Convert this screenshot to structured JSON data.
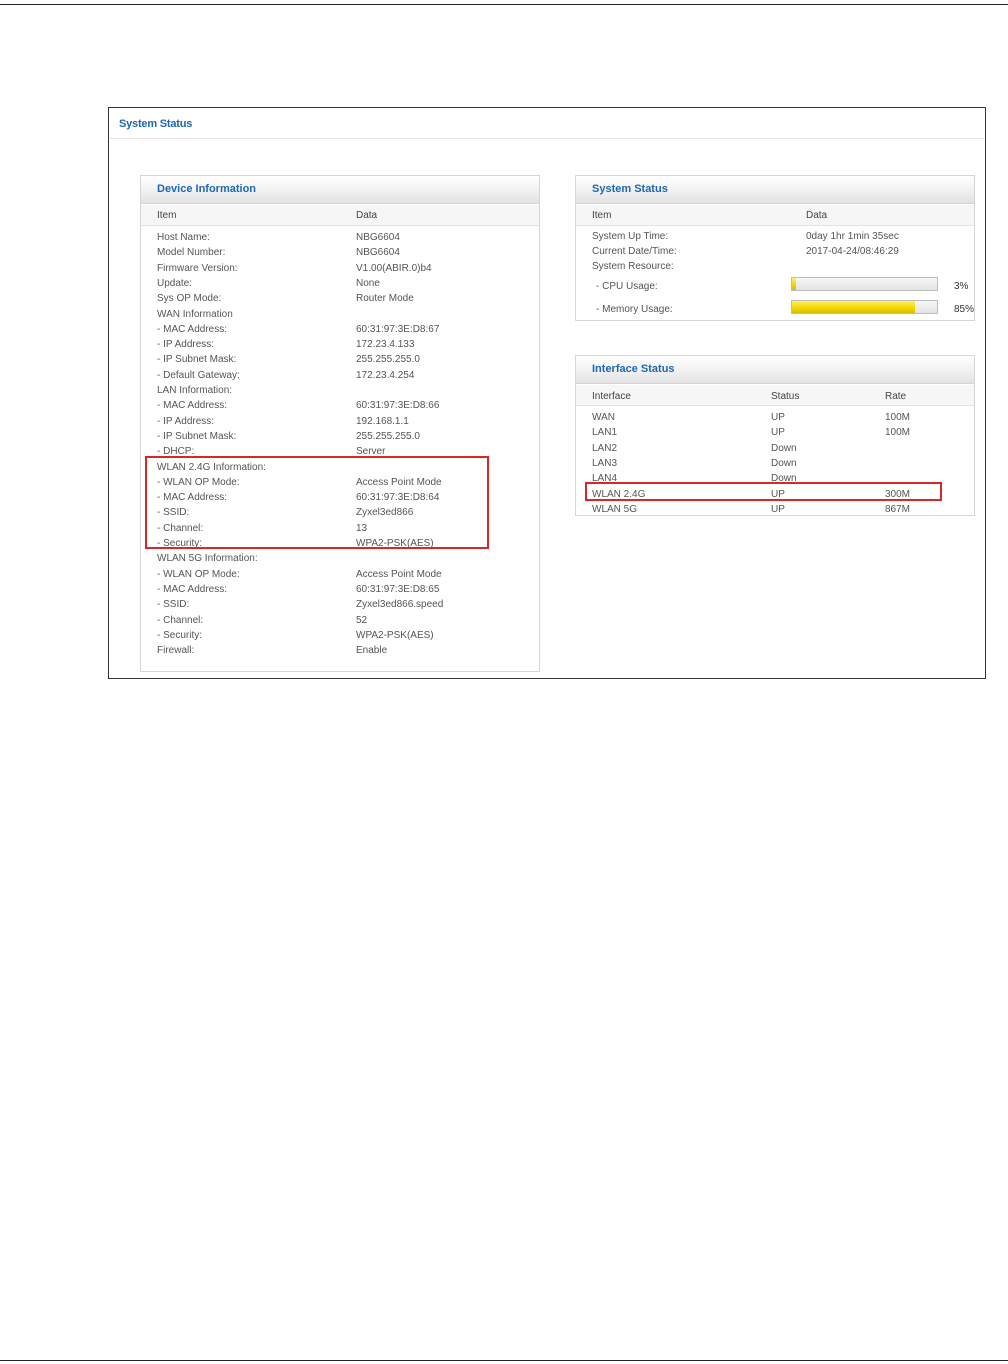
{
  "page_title": "System Status",
  "device_info": {
    "title": "Device Information",
    "col_item": "Item",
    "col_data": "Data",
    "rows": [
      {
        "item": "Host Name:",
        "data": "NBG6604"
      },
      {
        "item": "Model Number:",
        "data": "NBG6604"
      },
      {
        "item": "Firmware Version:",
        "data": "V1.00(ABIR.0)b4"
      },
      {
        "item": "Update:",
        "data": "None"
      },
      {
        "item": "Sys OP Mode:",
        "data": "Router Mode"
      },
      {
        "item": "WAN Information",
        "data": ""
      },
      {
        "item": "- MAC Address:",
        "data": "60:31:97:3E:D8:67"
      },
      {
        "item": "- IP Address:",
        "data": "172.23.4.133"
      },
      {
        "item": "- IP Subnet Mask:",
        "data": "255.255.255.0"
      },
      {
        "item": "- Default Gateway:",
        "data": "172.23.4.254"
      },
      {
        "item": "LAN Information:",
        "data": ""
      },
      {
        "item": "- MAC Address:",
        "data": "60:31:97:3E:D8:66"
      },
      {
        "item": "- IP Address:",
        "data": "192.168.1.1"
      },
      {
        "item": "- IP Subnet Mask:",
        "data": "255.255.255.0"
      },
      {
        "item": "- DHCP:",
        "data": "Server"
      },
      {
        "item": "WLAN 2.4G Information:",
        "data": ""
      },
      {
        "item": "- WLAN OP Mode:",
        "data": "Access Point Mode"
      },
      {
        "item": "- MAC Address:",
        "data": "60:31:97:3E:D8:64"
      },
      {
        "item": "- SSID:",
        "data": "Zyxel3ed866"
      },
      {
        "item": "- Channel:",
        "data": "13"
      },
      {
        "item": "- Security:",
        "data": "WPA2-PSK(AES)"
      },
      {
        "item": "WLAN 5G Information:",
        "data": ""
      },
      {
        "item": "- WLAN OP Mode:",
        "data": "Access Point Mode"
      },
      {
        "item": "- MAC Address:",
        "data": "60:31:97:3E:D8:65"
      },
      {
        "item": "- SSID:",
        "data": "Zyxel3ed866.speed"
      },
      {
        "item": "- Channel:",
        "data": "52"
      },
      {
        "item": "- Security:",
        "data": "WPA2-PSK(AES)"
      },
      {
        "item": "Firewall:",
        "data": "Enable"
      }
    ]
  },
  "system_status": {
    "title": "System Status",
    "col_item": "Item",
    "col_data": "Data",
    "up_time_label": "System Up Time:",
    "up_time_value": "0day 1hr 1min 35sec",
    "datetime_label": "Current Date/Time:",
    "datetime_value": "2017-04-24/08:46:29",
    "resource_label": "System Resource:",
    "cpu_label": "- CPU Usage:",
    "cpu_percent": 3,
    "cpu_text": "3%",
    "mem_label": "- Memory Usage:",
    "mem_percent": 85,
    "mem_text": "85%",
    "bar_color": "#f0d400"
  },
  "interface_status": {
    "title": "Interface Status",
    "col_interface": "Interface",
    "col_status": "Status",
    "col_rate": "Rate",
    "rows": [
      {
        "interface": "WAN",
        "status": "UP",
        "rate": "100M"
      },
      {
        "interface": "LAN1",
        "status": "UP",
        "rate": "100M"
      },
      {
        "interface": "LAN2",
        "status": "Down",
        "rate": ""
      },
      {
        "interface": "LAN3",
        "status": "Down",
        "rate": ""
      },
      {
        "interface": "LAN4",
        "status": "Down",
        "rate": ""
      },
      {
        "interface": "WLAN 2.4G",
        "status": "UP",
        "rate": "300M"
      },
      {
        "interface": "WLAN 5G",
        "status": "UP",
        "rate": "867M"
      }
    ]
  },
  "colors": {
    "accent_blue": "#1f66b5",
    "highlight_red": "#d62828"
  }
}
